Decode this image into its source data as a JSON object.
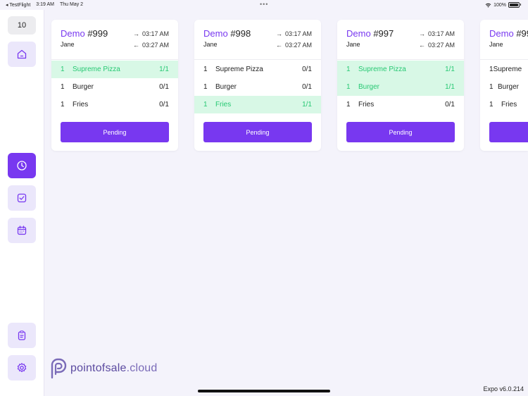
{
  "status_bar": {
    "back_app": "◂ TestFlight",
    "time": "3:19 AM",
    "date": "Thu May 2",
    "battery": "100%"
  },
  "sidebar": {
    "count": "10"
  },
  "orders": [
    {
      "source": "Demo",
      "number": "#999",
      "customer": "Jane",
      "time_in": "03:17 AM",
      "time_out": "03:27 AM",
      "items": [
        {
          "qty": "1",
          "name": "Supreme Pizza",
          "progress": "1/1",
          "done": true
        },
        {
          "qty": "1",
          "name": "Burger",
          "progress": "0/1",
          "done": false
        },
        {
          "qty": "1",
          "name": "Fries",
          "progress": "0/1",
          "done": false
        }
      ],
      "status_label": "Pending"
    },
    {
      "source": "Demo",
      "number": "#998",
      "customer": "Jane",
      "time_in": "03:17 AM",
      "time_out": "03:27 AM",
      "items": [
        {
          "qty": "1",
          "name": "Supreme Pizza",
          "progress": "0/1",
          "done": false
        },
        {
          "qty": "1",
          "name": "Burger",
          "progress": "0/1",
          "done": false
        },
        {
          "qty": "1",
          "name": "Fries",
          "progress": "1/1",
          "done": true
        }
      ],
      "status_label": "Pending"
    },
    {
      "source": "Demo",
      "number": "#997",
      "customer": "Jane",
      "time_in": "03:17 AM",
      "time_out": "03:27 AM",
      "items": [
        {
          "qty": "1",
          "name": "Supreme Pizza",
          "progress": "1/1",
          "done": true
        },
        {
          "qty": "1",
          "name": "Burger",
          "progress": "1/1",
          "done": true
        },
        {
          "qty": "1",
          "name": "Fries",
          "progress": "0/1",
          "done": false
        }
      ],
      "status_label": "Pending"
    },
    {
      "source": "Demo",
      "number": "#99",
      "customer": "Jane",
      "time_in": "",
      "time_out": "",
      "items": [
        {
          "qty": "1",
          "name": "Supreme",
          "progress": "",
          "done": false
        },
        {
          "qty": "1",
          "name": "Burger",
          "progress": "",
          "done": false
        },
        {
          "qty": "1",
          "name": "Fries",
          "progress": "",
          "done": false
        }
      ],
      "status_label": ""
    }
  ],
  "brand": {
    "name_main": "pointofsale",
    "name_suffix": ".cloud"
  },
  "footer": {
    "version": "Expo v6.0.214"
  },
  "colors": {
    "accent": "#7838f0",
    "done_bg": "#d8f8e6",
    "done_text": "#27c873"
  }
}
